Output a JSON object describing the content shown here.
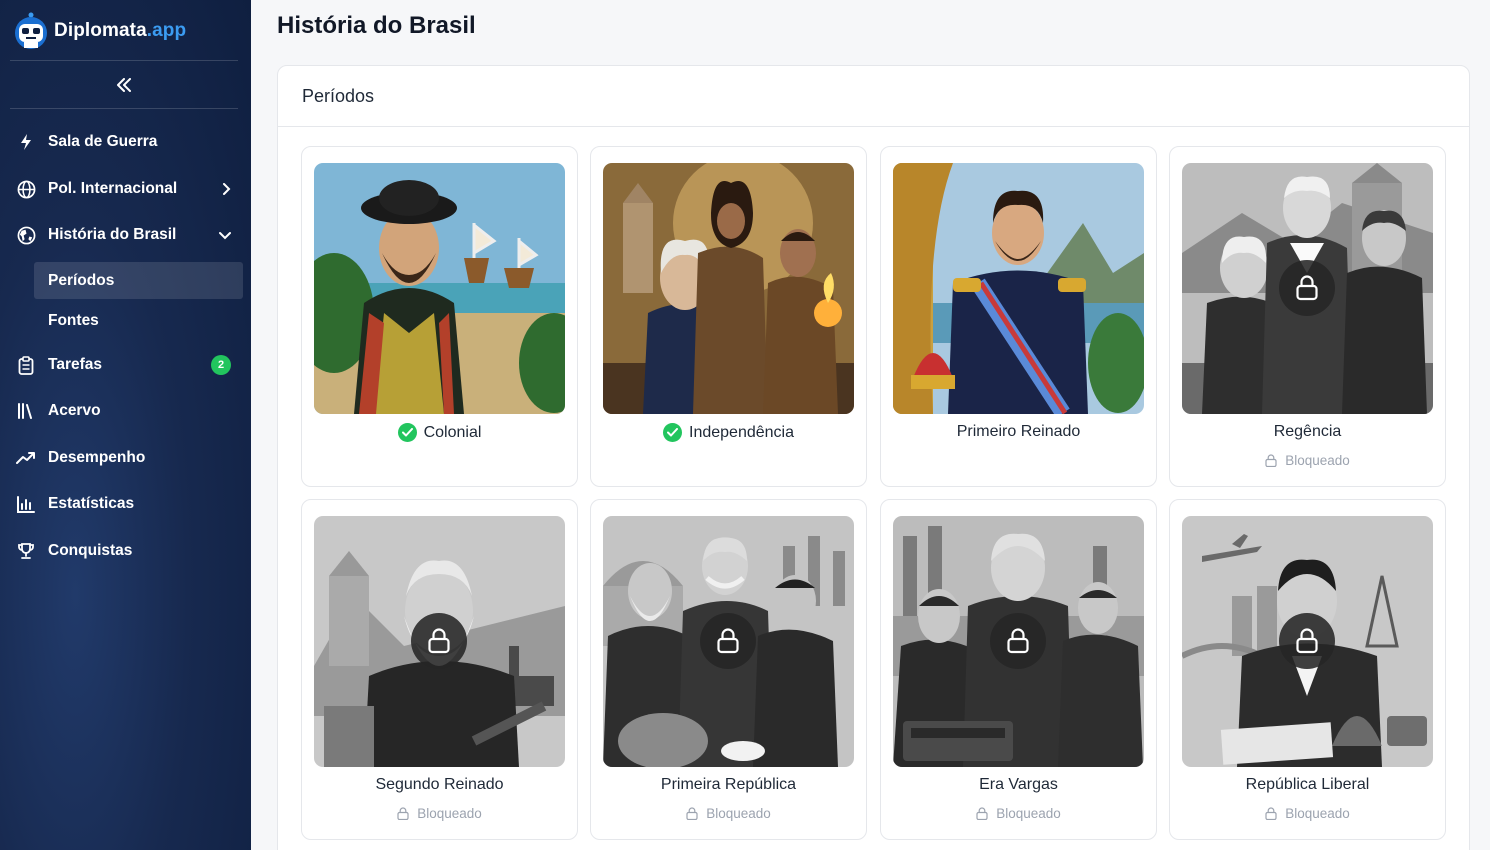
{
  "brand": {
    "name": "Diplomata",
    "tld": ".app"
  },
  "sidebar": {
    "items": [
      {
        "label": "Sala de Guerra",
        "icon": "bolt-icon"
      },
      {
        "label": "Pol. Internacional",
        "icon": "globe-icon"
      },
      {
        "label": "História do Brasil",
        "icon": "globe-americas-icon"
      },
      {
        "label": "Tarefas",
        "icon": "clipboard-icon",
        "badge": "2"
      },
      {
        "label": "Acervo",
        "icon": "library-icon"
      },
      {
        "label": "Desempenho",
        "icon": "trending-up-icon"
      },
      {
        "label": "Estatísticas",
        "icon": "bar-chart-icon"
      },
      {
        "label": "Conquistas",
        "icon": "trophy-icon"
      }
    ],
    "subitems": [
      {
        "label": "Períodos",
        "active": true
      },
      {
        "label": "Fontes",
        "active": false
      }
    ]
  },
  "page": {
    "title": "História do Brasil",
    "panel_title": "Períodos"
  },
  "periods": [
    {
      "title": "Colonial",
      "state": "completed",
      "status": ""
    },
    {
      "title": "Independência",
      "state": "completed",
      "status": ""
    },
    {
      "title": "Primeiro Reinado",
      "state": "available",
      "status": ""
    },
    {
      "title": "Regência",
      "state": "locked",
      "status": "Bloqueado"
    },
    {
      "title": "Segundo Reinado",
      "state": "locked",
      "status": "Bloqueado"
    },
    {
      "title": "Primeira República",
      "state": "locked",
      "status": "Bloqueado"
    },
    {
      "title": "Era Vargas",
      "state": "locked",
      "status": "Bloqueado"
    },
    {
      "title": "República Liberal",
      "state": "locked",
      "status": "Bloqueado"
    }
  ],
  "colors": {
    "sidebar_bg": "#17294f",
    "accent": "#3b9cf2",
    "success": "#22c55e"
  }
}
